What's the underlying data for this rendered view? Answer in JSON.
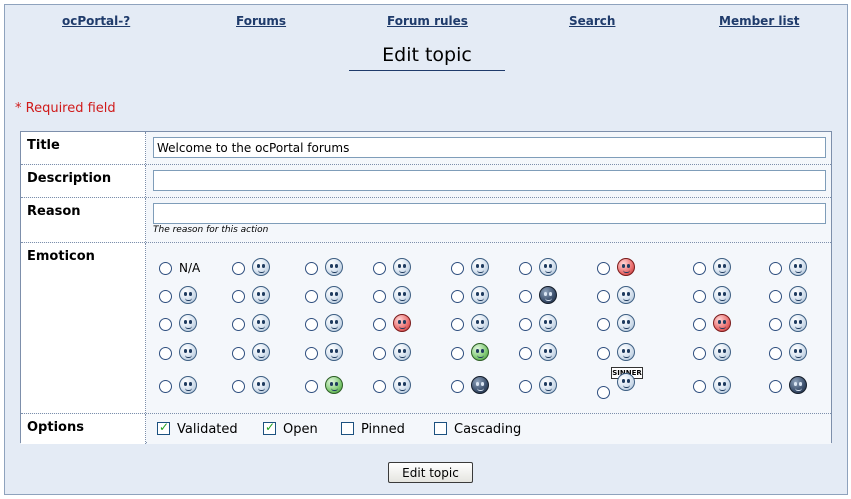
{
  "nav": {
    "items": [
      {
        "label": "ocPortal-?"
      },
      {
        "label": "Forums"
      },
      {
        "label": "Forum rules"
      },
      {
        "label": "Search"
      },
      {
        "label": "Member list"
      }
    ]
  },
  "page": {
    "title": "Edit topic",
    "required_note": "* Required field"
  },
  "form": {
    "title": {
      "label": "Title",
      "value": "Welcome to the ocPortal forums"
    },
    "description": {
      "label": "Description",
      "value": ""
    },
    "reason": {
      "label": "Reason",
      "value": "",
      "hint": "The reason for this action"
    },
    "emoticon": {
      "label": "Emoticon",
      "na_label": "N/A",
      "sign_text": "SINNER",
      "selected": null
    },
    "options": {
      "label": "Options",
      "items": [
        {
          "label": "Validated",
          "checked": true
        },
        {
          "label": "Open",
          "checked": true
        },
        {
          "label": "Pinned",
          "checked": false
        },
        {
          "label": "Cascading",
          "checked": false
        }
      ]
    }
  },
  "submit_label": "Edit topic",
  "colors": {
    "background": "#e4ebf5",
    "nav_link": "#1f3b6b",
    "required": "#d01a1a",
    "checkmark": "#21a121"
  }
}
